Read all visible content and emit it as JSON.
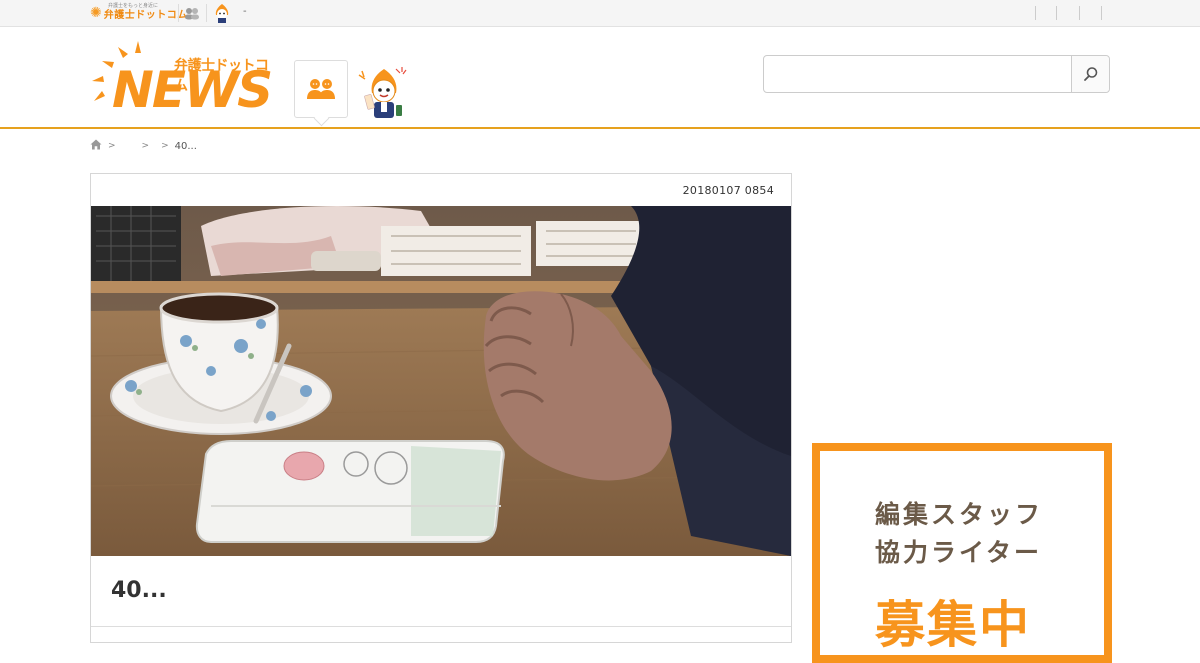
{
  "topbar": {
    "logo_text": "弁護士ドットコム",
    "logo_sub": "弁護士をもっと身近に",
    "dash": "-",
    "icons": [
      "people-icon",
      "mascot-icon"
    ]
  },
  "header": {
    "logo_kanji": "弁護士ドットコム",
    "logo_news": "NEWS",
    "search": {
      "placeholder": "",
      "value": ""
    },
    "icons": [
      "people-icon",
      "mascot-icon",
      "search-icon"
    ]
  },
  "breadcrumb": {
    "items": [
      "",
      "",
      "40..."
    ],
    "icons": [
      "home-icon"
    ]
  },
  "article": {
    "date": "20180107 0854",
    "title": "40..."
  },
  "banner": {
    "line1": "編集スタッフ",
    "line2": "協力ライター",
    "big": "募集中"
  },
  "colors": {
    "brand_orange": "#f7941d",
    "header_border": "#e6a11e",
    "banner_text": "#6b5a48"
  }
}
